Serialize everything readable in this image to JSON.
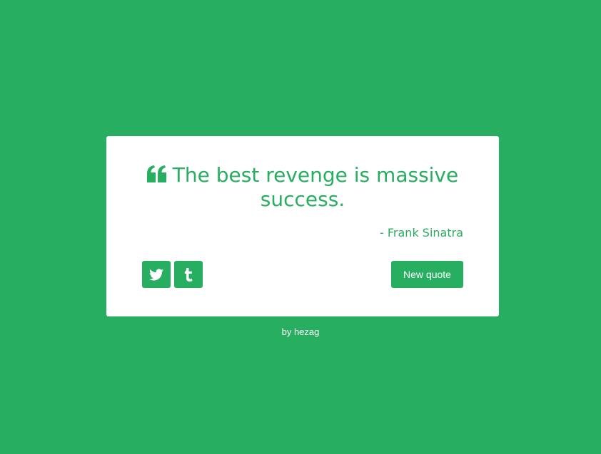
{
  "quote": {
    "text": "The best revenge is massive success.",
    "author": "- Frank Sinatra"
  },
  "buttons": {
    "twitter_icon": "twitter-icon",
    "tumblr_icon": "tumblr-icon",
    "new_quote_label": "New quote"
  },
  "footer": {
    "prefix": "by ",
    "author_link": "hezag"
  },
  "colors": {
    "background": "#27ae60",
    "card": "#ffffff",
    "accent": "#27ae60"
  }
}
